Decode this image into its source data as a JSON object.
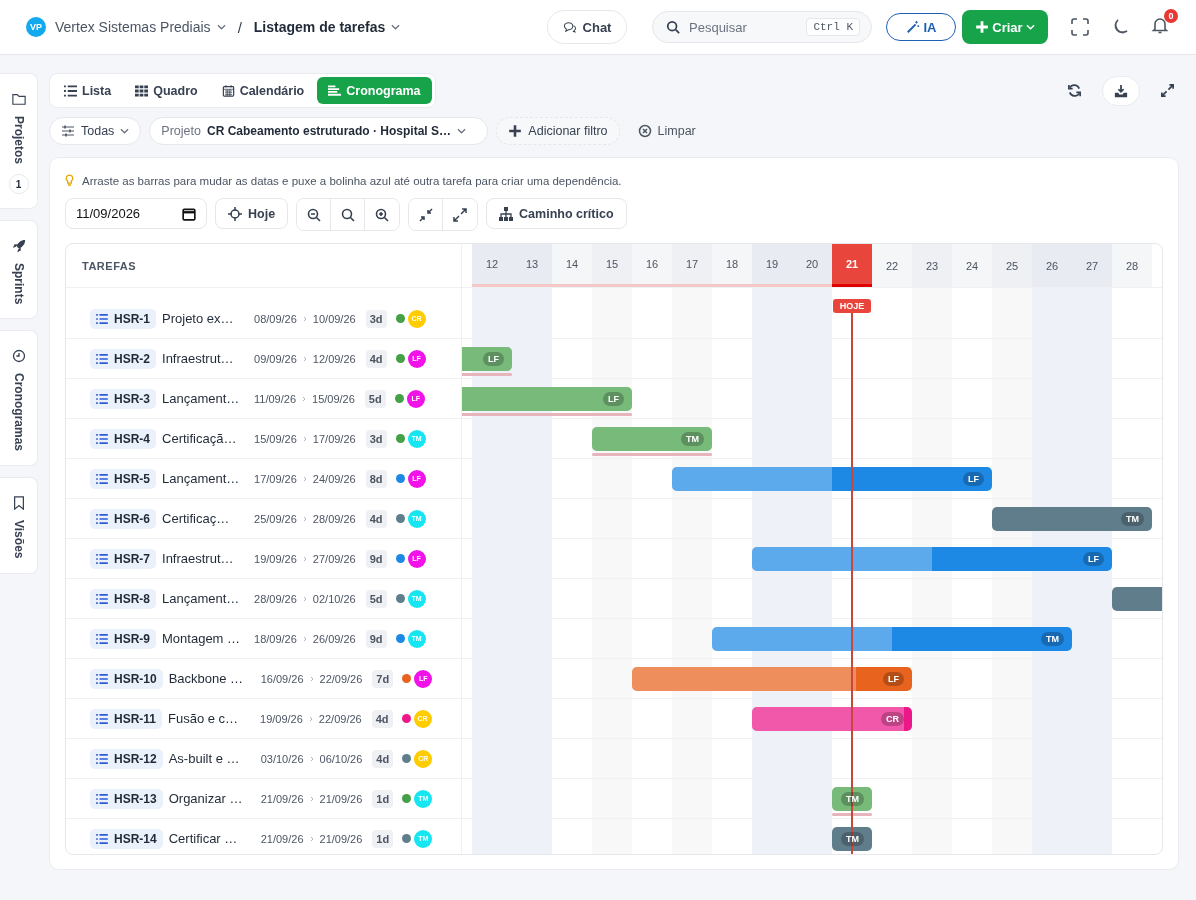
{
  "app": {
    "logo": "VP",
    "workspace": "Vertex Sistemas Prediais",
    "separator": "/",
    "page": "Listagem de tarefas"
  },
  "topbar": {
    "chat": "Chat",
    "search": {
      "placeholder": "Pesquisar",
      "shortcut": "Ctrl K"
    },
    "ai": "IA",
    "create": "Criar",
    "notifications": "0"
  },
  "rail": [
    {
      "label": "Projetos",
      "count": "1"
    },
    {
      "label": "Sprints"
    },
    {
      "label": "Cronogramas"
    },
    {
      "label": "Visões"
    }
  ],
  "views": [
    {
      "label": "Lista",
      "selected": false
    },
    {
      "label": "Quadro",
      "selected": false
    },
    {
      "label": "Calendário",
      "selected": false
    },
    {
      "label": "Cronograma",
      "selected": true
    }
  ],
  "filters": {
    "scope": "Todas",
    "project_label": "Projeto",
    "project": "CR Cabeamento estruturado · Hospital S…",
    "add": "Adicionar filtro",
    "clear": "Limpar"
  },
  "hint": "Arraste as barras para mudar as datas e puxe a bolinha azul até outra tarefa para criar uma dependência.",
  "toolbar": {
    "date": "11/09/2026",
    "today": "Hoje",
    "critical_path": "Caminho crítico"
  },
  "gantt": {
    "tasks_header": "TAREFAS",
    "today_label": "HOJE",
    "days": [
      {
        "label": "12",
        "kind": "weekend"
      },
      {
        "label": "13",
        "kind": "weekend"
      },
      {
        "label": "14",
        "kind": "normal"
      },
      {
        "label": "15",
        "kind": "alt"
      },
      {
        "label": "16",
        "kind": "normal"
      },
      {
        "label": "17",
        "kind": "alt"
      },
      {
        "label": "18",
        "kind": "normal"
      },
      {
        "label": "19",
        "kind": "weekend"
      },
      {
        "label": "20",
        "kind": "weekend"
      },
      {
        "label": "21",
        "kind": "today"
      },
      {
        "label": "22",
        "kind": "normal"
      },
      {
        "label": "23",
        "kind": "alt"
      },
      {
        "label": "24",
        "kind": "normal"
      },
      {
        "label": "25",
        "kind": "alt"
      },
      {
        "label": "26",
        "kind": "weekend"
      },
      {
        "label": "27",
        "kind": "weekend"
      },
      {
        "label": "28",
        "kind": "normal"
      }
    ],
    "tasks": [
      {
        "id": "HSR-1",
        "name": "Projeto ex…",
        "start": "08/09/26",
        "end": "10/09/26",
        "duration": "3d",
        "color": "#43a047",
        "avatar": {
          "initials": "CR",
          "color": "#ffcc00"
        }
      },
      {
        "id": "HSR-2",
        "name": "Infraestrut…",
        "start": "09/09/26",
        "end": "12/09/26",
        "duration": "4d",
        "color": "#43a047",
        "avatar": {
          "initials": "LF",
          "color": "#f012e8"
        },
        "bar_label": "LF",
        "level": 1,
        "critical": true
      },
      {
        "id": "HSR-3",
        "name": "Lançament…",
        "start": "11/09/26",
        "end": "15/09/26",
        "duration": "5d",
        "color": "#43a047",
        "avatar": {
          "initials": "LF",
          "color": "#f012e8"
        },
        "bar_label": "LF",
        "level": 1,
        "critical": true
      },
      {
        "id": "HSR-4",
        "name": "Certificaçã…",
        "start": "15/09/26",
        "end": "17/09/26",
        "duration": "3d",
        "color": "#43a047",
        "avatar": {
          "initials": "TM",
          "color": "#16e6f2"
        },
        "bar_label": "TM",
        "level": 1,
        "critical": true
      },
      {
        "id": "HSR-5",
        "name": "Lançament…",
        "start": "17/09/26",
        "end": "24/09/26",
        "duration": "8d",
        "color": "#1e88e5",
        "avatar": {
          "initials": "LF",
          "color": "#f012e8"
        },
        "bar_label": "LF",
        "level": 0.5
      },
      {
        "id": "HSR-6",
        "name": "Certificaç…",
        "start": "25/09/26",
        "end": "28/09/26",
        "duration": "4d",
        "color": "#607d8b",
        "avatar": {
          "initials": "TM",
          "color": "#16e6f2"
        },
        "bar_label": "TM"
      },
      {
        "id": "HSR-7",
        "name": "Infraestrut…",
        "start": "19/09/26",
        "end": "27/09/26",
        "duration": "9d",
        "color": "#1e88e5",
        "avatar": {
          "initials": "LF",
          "color": "#f012e8"
        },
        "bar_label": "LF",
        "level": 0.5
      },
      {
        "id": "HSR-8",
        "name": "Lançament…",
        "start": "28/09/26",
        "end": "02/10/26",
        "duration": "5d",
        "color": "#607d8b",
        "avatar": {
          "initials": "TM",
          "color": "#16e6f2"
        }
      },
      {
        "id": "HSR-9",
        "name": "Montagem …",
        "start": "18/09/26",
        "end": "26/09/26",
        "duration": "9d",
        "color": "#1e88e5",
        "avatar": {
          "initials": "TM",
          "color": "#16e6f2"
        },
        "bar_label": "TM",
        "level": 0.5
      },
      {
        "id": "HSR-10",
        "name": "Backbone …",
        "start": "16/09/26",
        "end": "22/09/26",
        "duration": "7d",
        "color": "#e8631e",
        "avatar": {
          "initials": "LF",
          "color": "#f012e8"
        },
        "bar_label": "LF",
        "level": 0.8
      },
      {
        "id": "HSR-11",
        "name": "Fusão e c…",
        "start": "19/09/26",
        "end": "22/09/26",
        "duration": "4d",
        "color": "#ec1889",
        "avatar": {
          "initials": "CR",
          "color": "#ffcc00"
        },
        "bar_label": "CR",
        "level": 0.95
      },
      {
        "id": "HSR-12",
        "name": "As-built e …",
        "start": "03/10/26",
        "end": "06/10/26",
        "duration": "4d",
        "color": "#607d8b",
        "avatar": {
          "initials": "CR",
          "color": "#ffcc00"
        }
      },
      {
        "id": "HSR-13",
        "name": "Organizar …",
        "start": "21/09/26",
        "end": "21/09/26",
        "duration": "1d",
        "color": "#43a047",
        "avatar": {
          "initials": "TM",
          "color": "#16e6f2"
        },
        "bar_label": "TM",
        "level": 1,
        "critical": true
      },
      {
        "id": "HSR-14",
        "name": "Certificar …",
        "start": "21/09/26",
        "end": "21/09/26",
        "duration": "1d",
        "color": "#607d8b",
        "avatar": {
          "initials": "TM",
          "color": "#16e6f2"
        },
        "bar_label": "TM"
      }
    ]
  }
}
